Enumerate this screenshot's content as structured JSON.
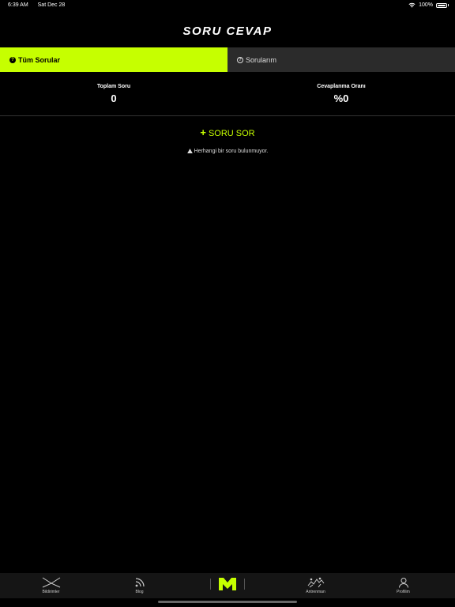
{
  "status": {
    "time": "6:39 AM",
    "date": "Sat Dec 28",
    "battery": "100%"
  },
  "header": {
    "title": "SORU CEVAP"
  },
  "tabs": [
    {
      "label": "Tüm Sorular",
      "active": true
    },
    {
      "label": "Sorularım",
      "active": false
    }
  ],
  "stats": {
    "total_label": "Toplam Soru",
    "total_value": "0",
    "rate_label": "Cevaplanma Oranı",
    "rate_value": "%0"
  },
  "actions": {
    "ask_label": "SORU SOR"
  },
  "empty_state": {
    "message": "Herhangi bir soru bulunmuyor."
  },
  "tabbar": {
    "items": [
      {
        "label": "Bildirimler",
        "icon": "notifications-icon"
      },
      {
        "label": "Blog",
        "icon": "rss-icon"
      },
      {
        "label": "",
        "icon": "brand-logo-icon"
      },
      {
        "label": "Antrenman",
        "icon": "workout-icon"
      },
      {
        "label": "Profilim",
        "icon": "profile-icon"
      }
    ]
  },
  "colors": {
    "accent": "#c6ff00",
    "background": "#000000",
    "tab_inactive": "#2b2b2b"
  }
}
